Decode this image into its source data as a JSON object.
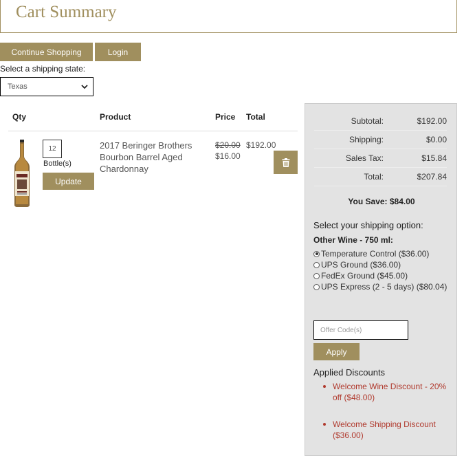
{
  "header": {
    "title": "Cart Summary"
  },
  "nav": {
    "continue_label": "Continue Shopping",
    "login_label": "Login"
  },
  "shipping_state": {
    "label": "Select a shipping state:",
    "selected": "Texas"
  },
  "table": {
    "headers": {
      "qty": "Qty",
      "product": "Product",
      "price": "Price",
      "total": "Total"
    },
    "items": [
      {
        "qty": "12",
        "unit": "Bottle(s)",
        "update_label": "Update",
        "name": "2017 Beringer Brothers Bourbon Barrel Aged Chardonnay",
        "price_original": "$20.00",
        "price_sale": "$16.00",
        "total": "$192.00"
      }
    ]
  },
  "summary": {
    "rows": [
      {
        "label": "Subtotal:",
        "value": "$192.00"
      },
      {
        "label": "Shipping:",
        "value": "$0.00"
      },
      {
        "label": "Sales Tax:",
        "value": "$15.84"
      },
      {
        "label": "Total:",
        "value": "$207.84"
      }
    ],
    "you_save": "You Save: $84.00",
    "shipping_option_title": "Select your shipping option:",
    "shipping_group": "Other Wine - 750 ml:",
    "shipping_options": [
      {
        "label": "Temperature Control ($36.00)",
        "selected": true
      },
      {
        "label": "UPS Ground ($36.00)",
        "selected": false
      },
      {
        "label": "FedEx Ground ($45.00)",
        "selected": false
      },
      {
        "label": "UPS Express (2 - 5 days) ($80.04)",
        "selected": false
      }
    ],
    "offer_placeholder": "Offer Code(s)",
    "apply_label": "Apply",
    "applied_title": "Applied Discounts",
    "discounts": [
      "Welcome Wine Discount - 20% off ($48.00)",
      "Welcome Shipping Discount ($36.00)"
    ]
  },
  "colors": {
    "accent": "#a08f5e",
    "summary_bg": "#e3e3e3",
    "discount_text": "#b03a2e"
  }
}
